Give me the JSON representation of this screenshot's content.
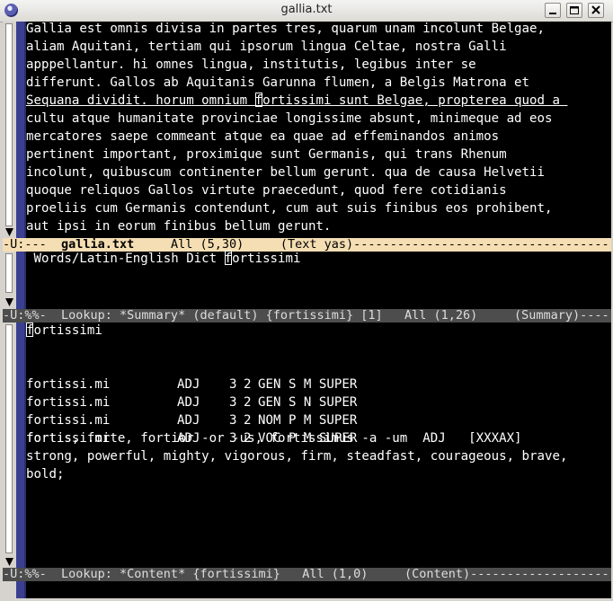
{
  "window": {
    "title": "gallia.txt",
    "buttons": [
      "minimize-icon",
      "maximize-icon",
      "close-icon"
    ]
  },
  "pane1": {
    "lines": [
      "Gallia est omnis divisa in partes tres, quarum unam incolunt Belgae,",
      "aliam Aquitani, tertiam qui ipsorum lingua Celtae, nostra Galli",
      "apppellantur. hi omnes lingua, institutis, legibus inter se",
      "differunt. Gallos ab Aquitanis Garunna flumen, a Belgis Matrona et",
      {
        "before": "Sequana dividit. horum omnium ",
        "cursor": "f",
        "after": "ortissimi sunt Belgae, propterea quod a "
      },
      "cultu atque humanitate provinciae longissime absunt, minimeque ad eos",
      "mercatores saepe commeant atque ea quae ad effeminandos animos",
      "pertinent important, proximique sunt Germanis, qui trans Rhenum",
      "incolunt, quibuscum continenter bellum gerunt. qua de causa Helvetii",
      "quoque reliquos Gallos virtute praecedunt, quod fere cotidianis",
      "proeliis cum Germanis contendunt, cum aut suis finibus eos prohibent,",
      "aut ipsi in eorum finibus bellum gerunt."
    ],
    "modeline": {
      "status": "-U:---  ",
      "buffer": "gallia.txt",
      "rest": "     All (5,30)     (Text yas)----------------------------------------"
    }
  },
  "pane2": {
    "prompt": " Words/Latin-English Dict ",
    "cursor": "f",
    "after": "ortissimi",
    "modeline": "-U:%%-  Lookup: *Summary* (default) {fortissimi} [1]   All (1,26)     (Summary)---------"
  },
  "pane3": {
    "heading_cursor": "f",
    "heading_rest": "ortissimi",
    "rows": [
      {
        "form": "fortissi.mi",
        "pos": "ADJ",
        "c1": "3",
        "c2": "2",
        "grammar": "GEN S M SUPER"
      },
      {
        "form": "fortissi.mi",
        "pos": "ADJ",
        "c1": "3",
        "c2": "2",
        "grammar": "GEN S N SUPER"
      },
      {
        "form": "fortissi.mi",
        "pos": "ADJ",
        "c1": "3",
        "c2": "2",
        "grammar": "NOM P M SUPER"
      },
      {
        "form": "fortissi.mi",
        "pos": "ADJ",
        "c1": "3",
        "c2": "2",
        "grammar": "VOC P M SUPER"
      }
    ],
    "definition": [
      "fortis, forte, fortior -or -us, fortissimus -a -um  ADJ   [XXXAX]",
      "strong, powerful, mighty, vigorous, firm, steadfast, courageous, brave,",
      "bold;"
    ],
    "modeline": "-U:%%-  Lookup: *Content* {fortissimi}   All (1,0)     (Content)--------------------------------"
  }
}
